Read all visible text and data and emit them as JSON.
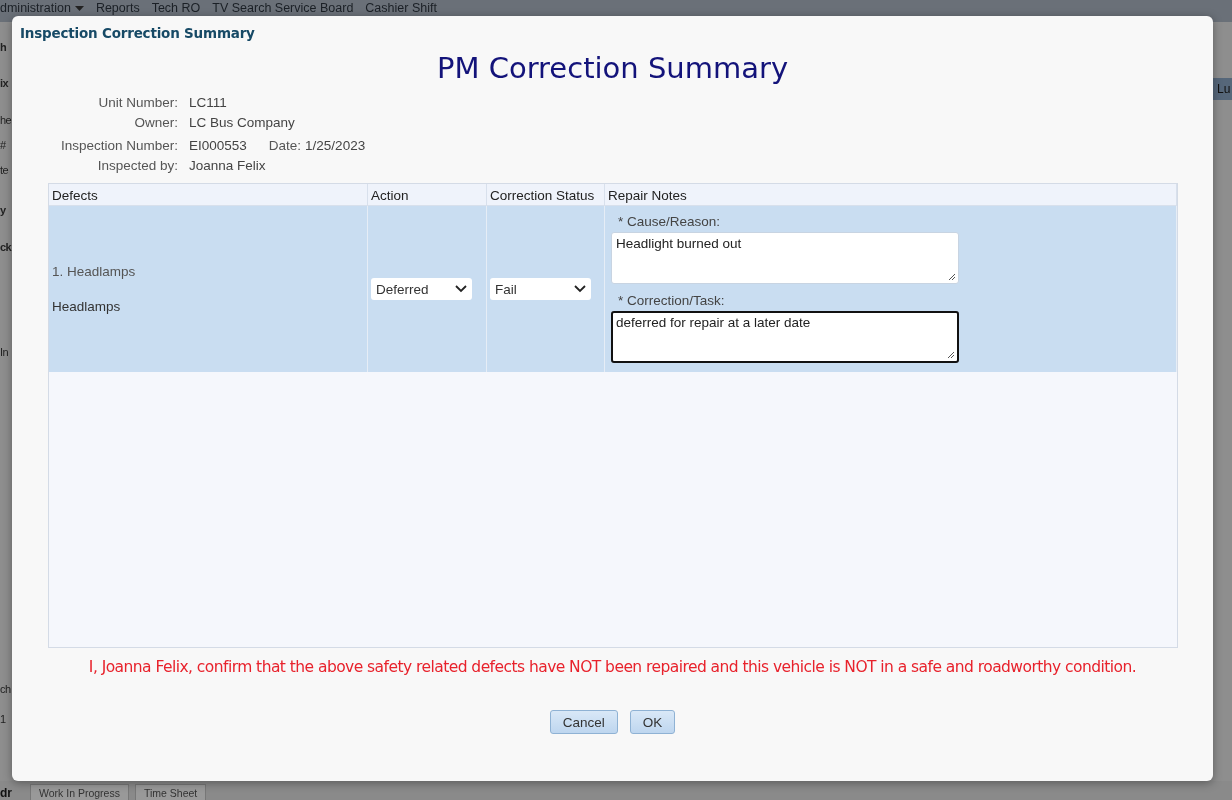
{
  "background": {
    "menu": [
      {
        "label": "dministration",
        "has_caret": true
      },
      {
        "label": "Reports",
        "has_caret": false
      },
      {
        "label": "Tech RO",
        "has_caret": false
      },
      {
        "label": "TV Search Service Board",
        "has_caret": false
      },
      {
        "label": "Cashier Shift",
        "has_caret": false
      }
    ],
    "left_fragments": [
      {
        "text": "h",
        "bold": true
      },
      {
        "text": "ix",
        "bold": true
      },
      {
        "text": "he",
        "bold": false
      },
      {
        "text": "#",
        "bold": false
      },
      {
        "text": "te",
        "bold": false
      },
      {
        "text": "y",
        "bold": true
      },
      {
        "text": "ck",
        "bold": true
      },
      {
        "text": "In",
        "bold": false
      },
      {
        "text": "ch",
        "bold": false
      },
      {
        "text": "1",
        "bold": false
      }
    ],
    "right_button": "Lu",
    "bottom_label": "dr",
    "bottom_tabs": [
      {
        "label": "Work In Progress",
        "selected": false
      },
      {
        "label": "Time Sheet",
        "selected": false
      }
    ]
  },
  "dialog": {
    "title": "Inspection Correction Summary",
    "heading": "PM Correction Summary",
    "info": [
      {
        "label": "Unit Number:",
        "value": "LC111"
      },
      {
        "label": "Owner:",
        "value": "LC Bus Company"
      },
      {
        "label": "Inspection Number:",
        "value": "EI000553",
        "extra_label": "Date:",
        "extra_value": "1/25/2023"
      },
      {
        "label": "Inspected by:",
        "value": "Joanna Felix"
      }
    ],
    "table": {
      "columns": [
        "Defects",
        "Action",
        "Correction Status",
        "Repair Notes"
      ],
      "rows": [
        {
          "defect_number": "1. Headlamps",
          "defect_name": "Headlamps",
          "action": "Deferred",
          "status": "Fail",
          "selected": true,
          "notes": [
            {
              "label": "* Cause/Reason:",
              "value": "Headlight burned out",
              "focused": false
            },
            {
              "label": "* Correction/Task:",
              "value": "deferred for repair at a later date",
              "focused": true
            }
          ]
        }
      ]
    },
    "confirmation": "I, Joanna Felix, confirm that the above safety related defects have NOT been repaired and this vehicle is NOT in a safe and roadworthy condition.",
    "buttons": [
      "Cancel",
      "OK"
    ]
  }
}
